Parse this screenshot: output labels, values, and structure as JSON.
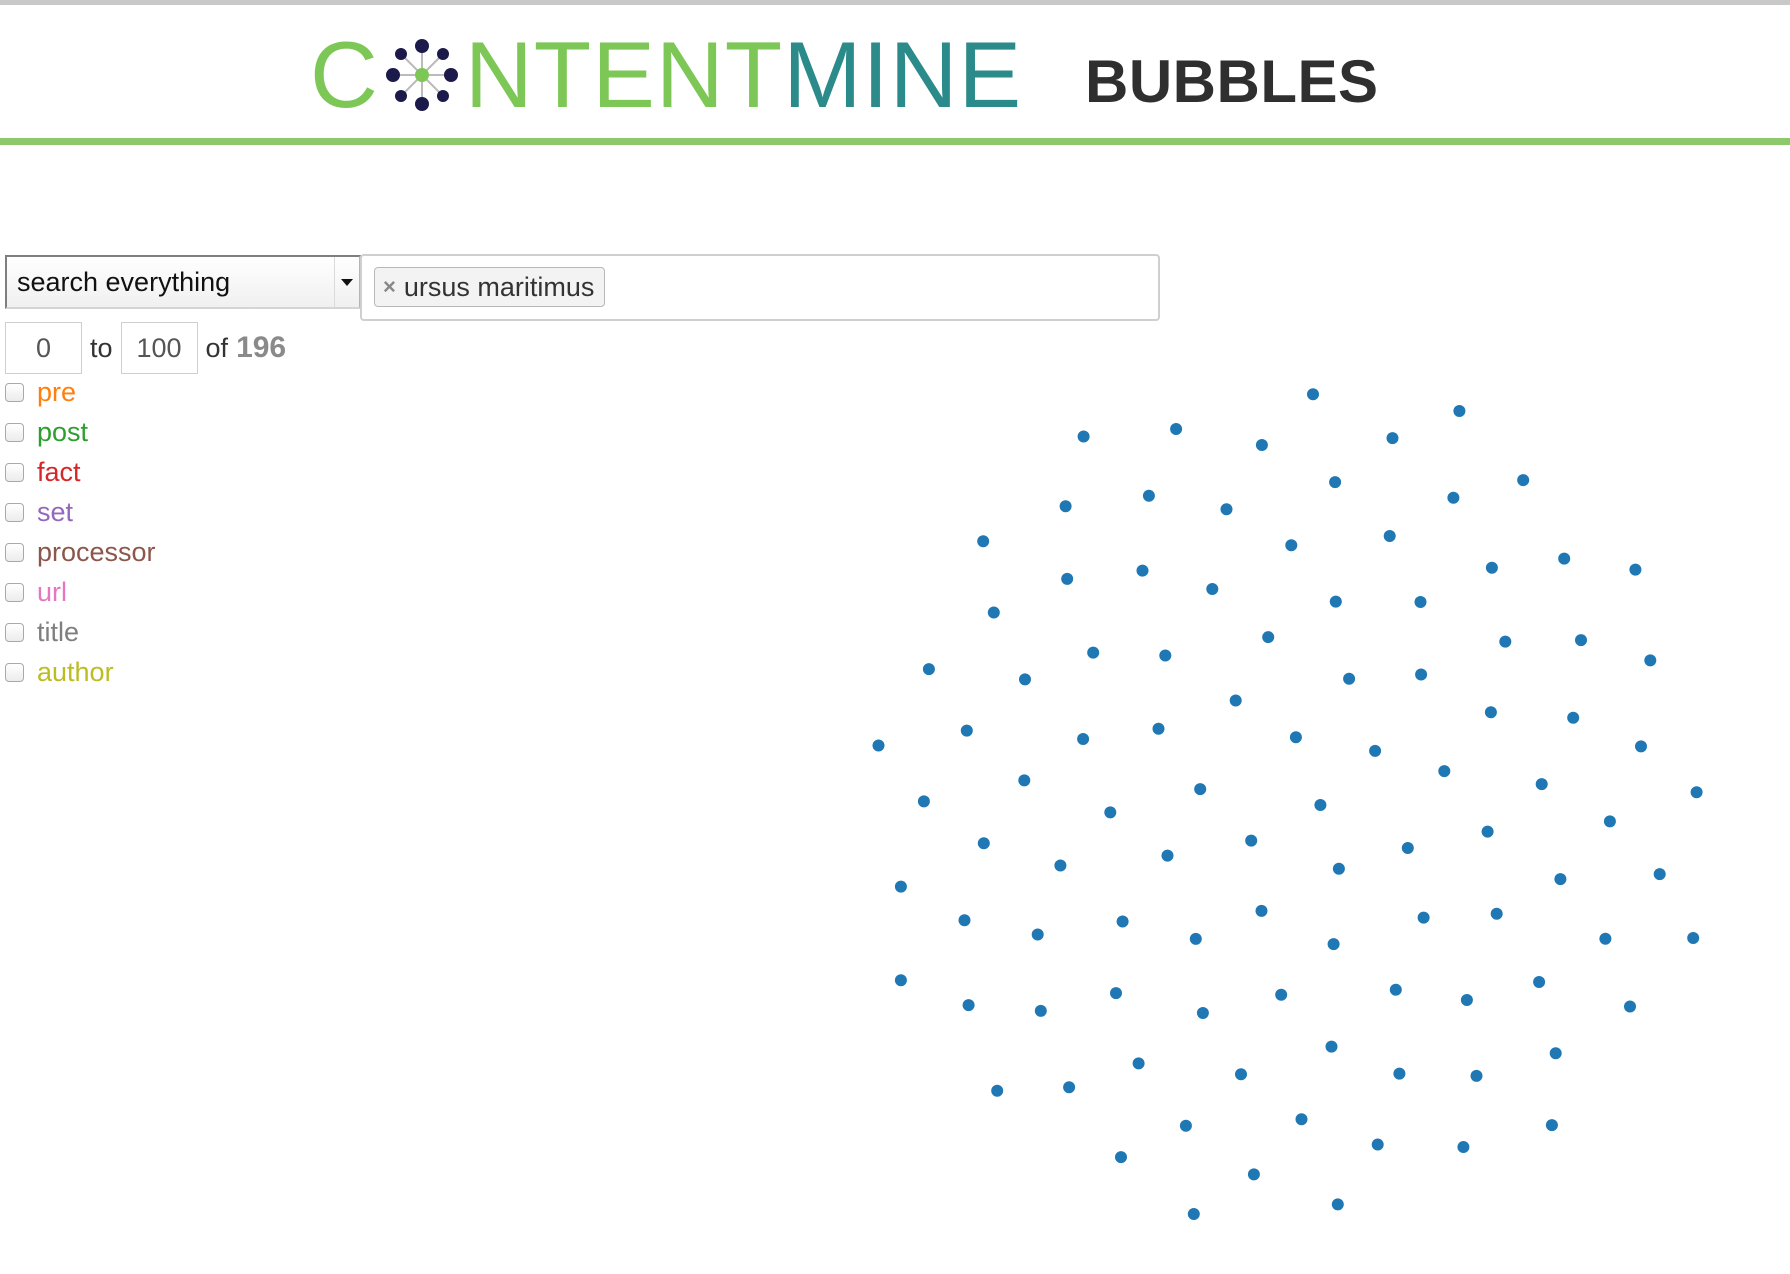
{
  "header": {
    "logo": {
      "brand_prefix": "C",
      "brand_mid": "NTENT",
      "brand_suffix": "MINE"
    },
    "app_title": "BUBBLES"
  },
  "search": {
    "scope_value": "search everything",
    "tags": [
      "ursus maritimus"
    ]
  },
  "range": {
    "from": "0",
    "to_label": "to",
    "to": "100",
    "of_label": "of",
    "total": "196"
  },
  "facets": [
    {
      "label": "pre",
      "color": "#ff7f0e",
      "checked": false
    },
    {
      "label": "post",
      "color": "#2ca02c",
      "checked": false
    },
    {
      "label": "fact",
      "color": "#d62728",
      "checked": false
    },
    {
      "label": "set",
      "color": "#9467bd",
      "checked": false
    },
    {
      "label": "processor",
      "color": "#8c564b",
      "checked": false
    },
    {
      "label": "url",
      "color": "#e377c2",
      "checked": false
    },
    {
      "label": "title",
      "color": "#7f7f7f",
      "checked": false
    },
    {
      "label": "author",
      "color": "#bcbd22",
      "checked": false
    }
  ],
  "colors": {
    "brand_green": "#7dc756",
    "brand_teal": "#2b8a8a",
    "header_rule": "#8dc96b",
    "bubble": "#1f78b4"
  },
  "visualization": {
    "bubble_count": 100
  }
}
